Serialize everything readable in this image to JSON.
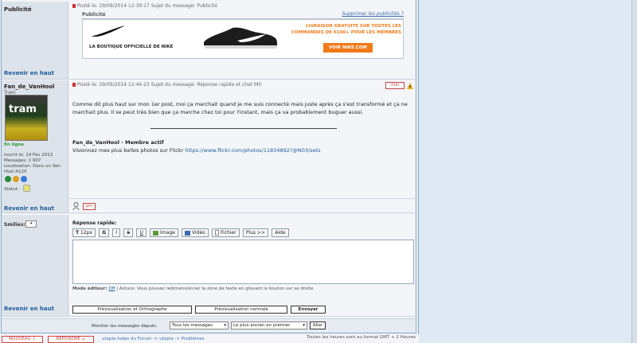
{
  "ad_post": {
    "author": "Publicité",
    "header": "Posté le: 29/09/2014 12:39:17    Sujet du message: Publicité",
    "title": "Publicité",
    "remove_link": "Supprimer les publicités ?",
    "ad_brand": "LA BOUTIQUE OFFICIELLE DE NIKE",
    "ad_promo_line1": "LIVRAISON GRATUITE SUR TOUTES LES",
    "ad_promo_line2": "COMMANDES DE €100+ POUR LES MEMBRES",
    "ad_cta": "VOIR NIKE.COM",
    "back_to_top": "Revenir en haut"
  },
  "post": {
    "author": "Fan_de_VanHool",
    "rank": "Tram",
    "avatar_text": "tram",
    "online": "En ligne",
    "joined": "Inscrit le: 14 Fév 2013",
    "messages": "Messages: 1 907",
    "location": "Localisation: Dans un Van Hool A120",
    "status_label": "Statut:",
    "header": "Posté le: 29/09/2014 12:44:23    Sujet du message: Réponse rapide et chat MS",
    "quote_btn": "citer",
    "body": "Comme dit plus haut sur mon 1er post, moi ça marchait quand je me suis connecté mais juste après ça s'est transformé et ça ne marchait plus. Il se peut très bien que ça marche chez toi pour l'instant, mais ça va probablement buguer aussi.",
    "sig_name": "Fan_de_VanHool - Membre actif",
    "sig_text": "Visionnez mes plus belles photos sur Flickr",
    "sig_link": "https://www.flickr.com/photos/11834892?@N03/sets",
    "back_to_top": "Revenir en haut",
    "pm_btn": "pm"
  },
  "reply": {
    "smilies_label": "Smilies:",
    "title": "Réponse rapide:",
    "font_size": "12px",
    "tools": [
      "G",
      "I",
      "S",
      "U"
    ],
    "image_btn": "Image",
    "video_btn": "Vidéo",
    "file_btn": "Fichier",
    "more_btn": "Plus >>",
    "help_btn": "Aide",
    "editor_mode_label": "Mode éditeur:",
    "editor_mode_value": "Off",
    "editor_hint": "| Astuce: Vous pouvez redimensionner la zone de texte en glissant le bouton sur sa droite.",
    "back_to_top": "Revenir en haut",
    "preview_spell": "Prévisualisation et Orthographe",
    "preview_normal": "Prévisualisation normale",
    "send": "Envoyer"
  },
  "footer": {
    "show_label": "Montrer les messages depuis:",
    "show_value": "Tous les messages",
    "order_value": "Le plus ancien en premier",
    "go": "Aller",
    "new_btn": "NOUVEAU",
    "reply_btn": "RÉPONDRE",
    "breadcrumb": "utopia Index du Forum -> utopia -> Problèmes",
    "timezone": "Toutes les heures sont au format GMT + 2 Heures"
  }
}
